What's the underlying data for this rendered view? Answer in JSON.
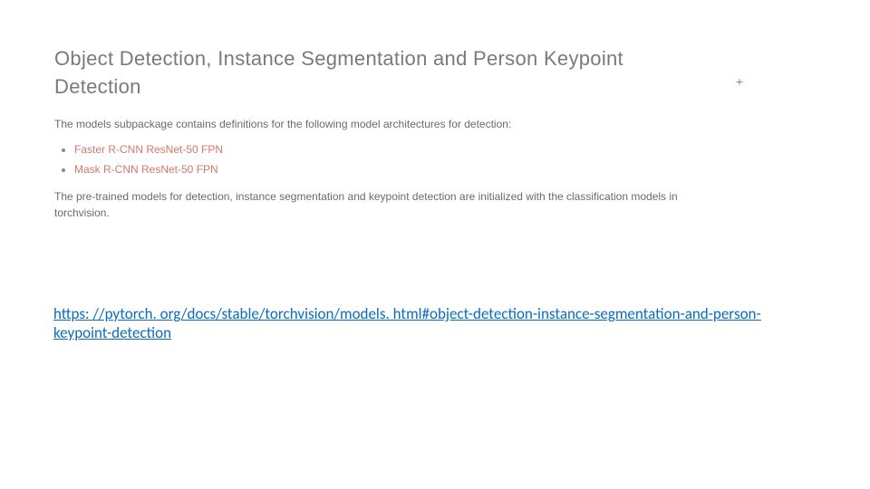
{
  "doc": {
    "section_title": "Object Detection, Instance Segmentation and Person Keypoint Detection",
    "intro": "The models subpackage contains definitions for the following model architectures for detection:",
    "models": [
      {
        "label": "Faster R-CNN ResNet-50 FPN"
      },
      {
        "label": "Mask R-CNN ResNet-50 FPN"
      }
    ],
    "pretrained": "The pre-trained models for detection, instance segmentation and keypoint detection are initialized with the classification models in torchvision.",
    "anchor_symbol": "+"
  },
  "citation": {
    "text": "https: //pytorch. org/docs/stable/torchvision/models. html#object-detection-instance-segmentation-and-person-keypoint-detection"
  }
}
